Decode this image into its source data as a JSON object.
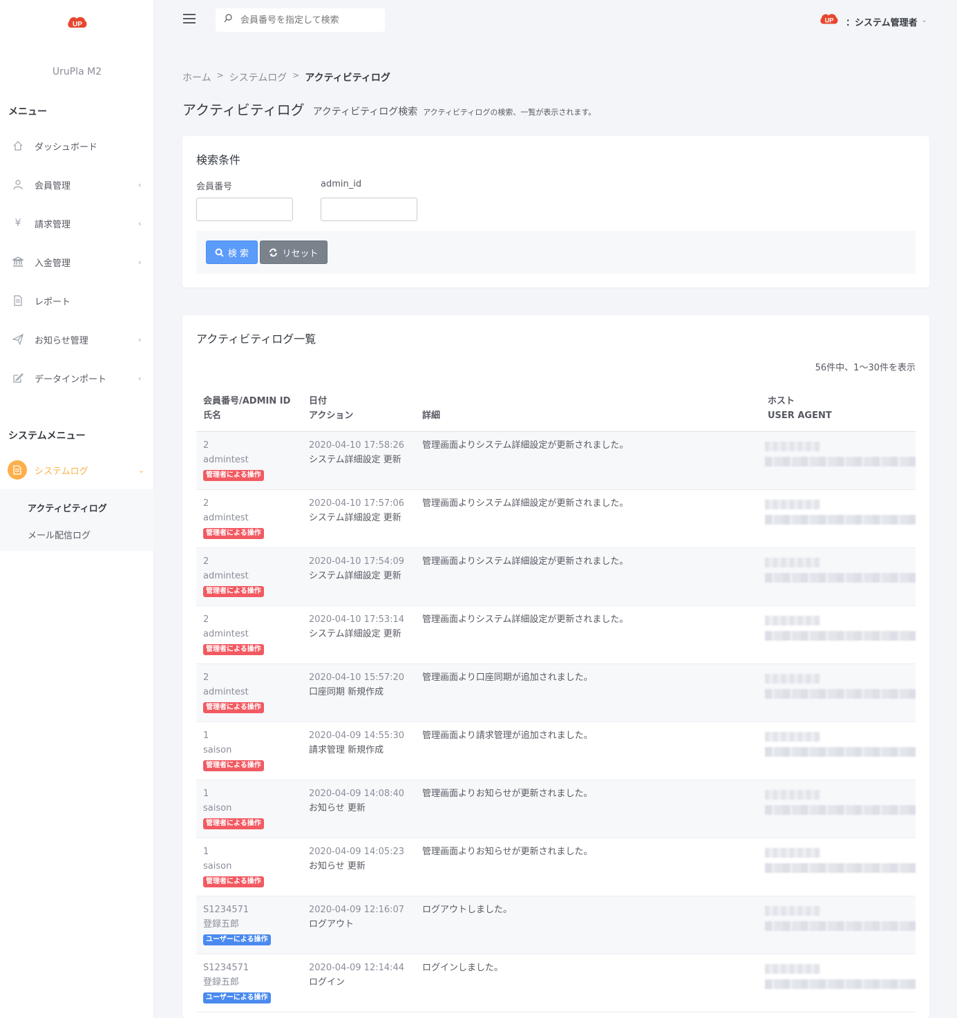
{
  "app": {
    "name": "UruPla M2"
  },
  "sidebar": {
    "menu_title": "メニュー",
    "items": [
      {
        "label": "ダッシュボード",
        "icon": "home-icon",
        "chevron": ""
      },
      {
        "label": "会員管理",
        "icon": "user-icon",
        "chevron": "‹"
      },
      {
        "label": "請求管理",
        "icon": "yen-icon",
        "chevron": "‹"
      },
      {
        "label": "入金管理",
        "icon": "bank-icon",
        "chevron": "‹"
      },
      {
        "label": "レポート",
        "icon": "document-icon",
        "chevron": ""
      },
      {
        "label": "お知らせ管理",
        "icon": "paper-plane-icon",
        "chevron": "‹"
      },
      {
        "label": "データインポート",
        "icon": "edit-icon",
        "chevron": "‹"
      }
    ],
    "system_menu_title": "システムメニュー",
    "system_log": {
      "label": "システムログ",
      "icon": "file-icon",
      "chevron": "⌄"
    },
    "sub_items": [
      {
        "label": "アクティビティログ"
      },
      {
        "label": "メール配信ログ"
      }
    ]
  },
  "header": {
    "search_placeholder": "会員番号を指定して検索",
    "user_label": "：システム管理者"
  },
  "breadcrumb": {
    "home": "ホーム",
    "sep": ">",
    "level1": "システムログ",
    "current": "アクティビティログ"
  },
  "page": {
    "title": "アクティビティログ",
    "subtitle": "アクティビティログ検索",
    "description": "アクティビティログの検索、一覧が表示されます。"
  },
  "search_card": {
    "title": "検索条件",
    "field1_label": "会員番号",
    "field1_value": "",
    "field2_label": "admin_id",
    "field2_value": "",
    "search_button": "検 索",
    "reset_button": "リセット"
  },
  "list_card": {
    "title": "アクティビティログ一覧",
    "count_text": "56件中、1〜30件を表示",
    "headers": {
      "col1_line1": "会員番号/ADMIN ID",
      "col1_line2": "氏名",
      "col2_line1": "日付",
      "col2_line2": "アクション",
      "col3": "詳細",
      "col4_line1": "ホスト",
      "col4_line2": "USER AGENT"
    },
    "rows": [
      {
        "id": "2",
        "name": "admintest",
        "badge": "管理者による操作",
        "badge_type": "admin",
        "date": "2020-04-10 17:58:26",
        "action": "システム詳細設定 更新",
        "detail": "管理画面よりシステム詳細設定が更新されました。"
      },
      {
        "id": "2",
        "name": "admintest",
        "badge": "管理者による操作",
        "badge_type": "admin",
        "date": "2020-04-10 17:57:06",
        "action": "システム詳細設定 更新",
        "detail": "管理画面よりシステム詳細設定が更新されました。"
      },
      {
        "id": "2",
        "name": "admintest",
        "badge": "管理者による操作",
        "badge_type": "admin",
        "date": "2020-04-10 17:54:09",
        "action": "システム詳細設定 更新",
        "detail": "管理画面よりシステム詳細設定が更新されました。"
      },
      {
        "id": "2",
        "name": "admintest",
        "badge": "管理者による操作",
        "badge_type": "admin",
        "date": "2020-04-10 17:53:14",
        "action": "システム詳細設定 更新",
        "detail": "管理画面よりシステム詳細設定が更新されました。"
      },
      {
        "id": "2",
        "name": "admintest",
        "badge": "管理者による操作",
        "badge_type": "admin",
        "date": "2020-04-10 15:57:20",
        "action": "口座同期 新規作成",
        "detail": "管理画面より口座同期が追加されました。"
      },
      {
        "id": "1",
        "name": "saison",
        "badge": "管理者による操作",
        "badge_type": "admin",
        "date": "2020-04-09 14:55:30",
        "action": "請求管理 新規作成",
        "detail": "管理画面より請求管理が追加されました。"
      },
      {
        "id": "1",
        "name": "saison",
        "badge": "管理者による操作",
        "badge_type": "admin",
        "date": "2020-04-09 14:08:40",
        "action": "お知らせ 更新",
        "detail": "管理画面よりお知らせが更新されました。"
      },
      {
        "id": "1",
        "name": "saison",
        "badge": "管理者による操作",
        "badge_type": "admin",
        "date": "2020-04-09 14:05:23",
        "action": "お知らせ 更新",
        "detail": "管理画面よりお知らせが更新されました。"
      },
      {
        "id": "S1234571",
        "name": "登録五郎",
        "badge": "ユーザーによる操作",
        "badge_type": "user",
        "date": "2020-04-09 12:16:07",
        "action": "ログアウト",
        "detail": "ログアウトしました。"
      },
      {
        "id": "S1234571",
        "name": "登録五郎",
        "badge": "ユーザーによる操作",
        "badge_type": "user",
        "date": "2020-04-09 12:14:44",
        "action": "ログイン",
        "detail": "ログインしました。"
      }
    ]
  },
  "colors": {
    "accent_orange": "#fdaf4b",
    "badge_admin": "#f25961",
    "badge_user": "#4a8af0",
    "button_primary": "#5b9bfa",
    "button_secondary": "#7a838c",
    "brand_red": "#e8472f"
  }
}
